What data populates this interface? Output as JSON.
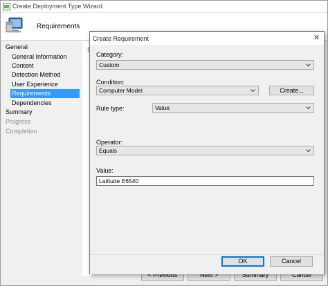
{
  "wizard": {
    "title": "Create Deployment Type Wizard",
    "header_title": "Requirements",
    "content_link_glyph": "S",
    "nav": [
      {
        "label": "General",
        "level": 0,
        "state": "normal"
      },
      {
        "label": "General Information",
        "level": 1,
        "state": "normal"
      },
      {
        "label": "Content",
        "level": 1,
        "state": "normal"
      },
      {
        "label": "Detection Method",
        "level": 1,
        "state": "normal"
      },
      {
        "label": "User Experience",
        "level": 1,
        "state": "normal"
      },
      {
        "label": "Requirements",
        "level": 1,
        "state": "selected"
      },
      {
        "label": "Dependencies",
        "level": 1,
        "state": "normal"
      },
      {
        "label": "Summary",
        "level": 0,
        "state": "normal"
      },
      {
        "label": "Progress",
        "level": 0,
        "state": "disabled"
      },
      {
        "label": "Completion",
        "level": 0,
        "state": "disabled"
      }
    ],
    "bottom_buttons": {
      "previous": "< Previous",
      "next": "Next >",
      "summary": "Summary",
      "cancel": "Cancel"
    }
  },
  "dialog": {
    "title": "Create Requirement",
    "close_glyph": "✕",
    "category_label": "Category:",
    "category_value": "Custom",
    "condition_label": "Condition:",
    "condition_value": "Computer Model",
    "create_button": "Create...",
    "rule_type_label": "Rule type:",
    "rule_type_value": "Value",
    "operator_label": "Operator:",
    "operator_value": "Equals",
    "value_label": "Value:",
    "value_value": "Latitude E6540",
    "ok_button": "OK",
    "cancel_button": "Cancel"
  },
  "colors": {
    "selection": "#3399ff",
    "link": "#1a5fb4",
    "ok_border": "#0078d7"
  }
}
